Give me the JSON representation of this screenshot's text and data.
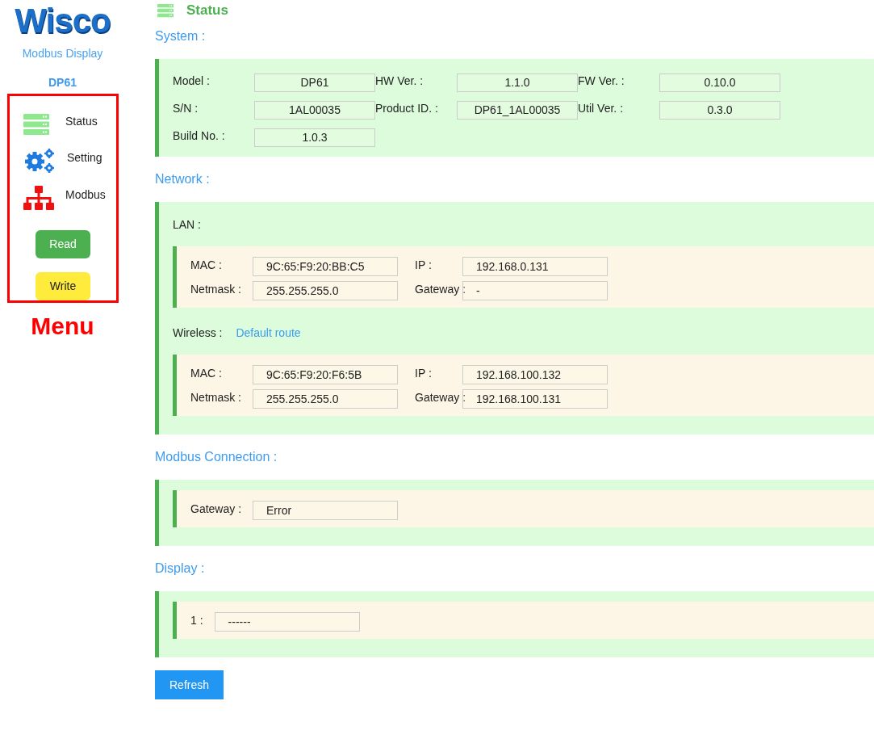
{
  "sidebar": {
    "logo": "Wisco",
    "subtitle": "Modbus Display",
    "device": "DP61",
    "menu": [
      {
        "label": "Status",
        "kind": "status"
      },
      {
        "label": "Setting",
        "kind": "setting"
      },
      {
        "label": "Modbus",
        "kind": "modbus"
      }
    ],
    "buttons": [
      {
        "label": "Read",
        "kind": "read"
      },
      {
        "label": "Write",
        "kind": "write"
      }
    ],
    "annotation": "Menu"
  },
  "header": {
    "title": "Status"
  },
  "sections": [
    {
      "title": "System :",
      "kind": "grid",
      "fields": [
        {
          "label": "Model :",
          "value": "DP61"
        },
        {
          "label": "HW Ver. :",
          "value": "1.1.0"
        },
        {
          "label": "FW Ver. :",
          "value": "0.10.0"
        },
        {
          "label": "S/N :",
          "value": "1AL00035"
        },
        {
          "label": "Product ID. :",
          "value": "DP61_1AL00035"
        },
        {
          "label": "Util Ver. :",
          "value": "0.3.0"
        },
        {
          "label": "Build No. :",
          "value": "1.0.3"
        }
      ]
    },
    {
      "title": "Network :",
      "kind": "groups",
      "groups": [
        {
          "label": "LAN :",
          "fields": [
            {
              "label": "MAC :",
              "value": "9C:65:F9:20:BB:C5"
            },
            {
              "label": "IP :",
              "value": "192.168.0.131"
            },
            {
              "label": "Netmask :",
              "value": "255.255.255.0"
            },
            {
              "label": "Gateway :",
              "value": "-"
            }
          ]
        },
        {
          "label": "Wireless :",
          "link": "Default route",
          "fields": [
            {
              "label": "MAC :",
              "value": "9C:65:F9:20:F6:5B"
            },
            {
              "label": "IP :",
              "value": "192.168.100.132"
            },
            {
              "label": "Netmask :",
              "value": "255.255.255.0"
            },
            {
              "label": "Gateway :",
              "value": "192.168.100.131"
            }
          ]
        }
      ]
    },
    {
      "title": "Modbus Connection :",
      "kind": "groups",
      "groups": [
        {
          "fields": [
            {
              "label": "Gateway :",
              "value": "Error"
            }
          ]
        }
      ]
    },
    {
      "title": "Display :",
      "kind": "groups",
      "groups": [
        {
          "fields": [
            {
              "label": "1 :",
              "value": "------"
            }
          ]
        }
      ]
    }
  ],
  "refresh_button": "Refresh"
}
